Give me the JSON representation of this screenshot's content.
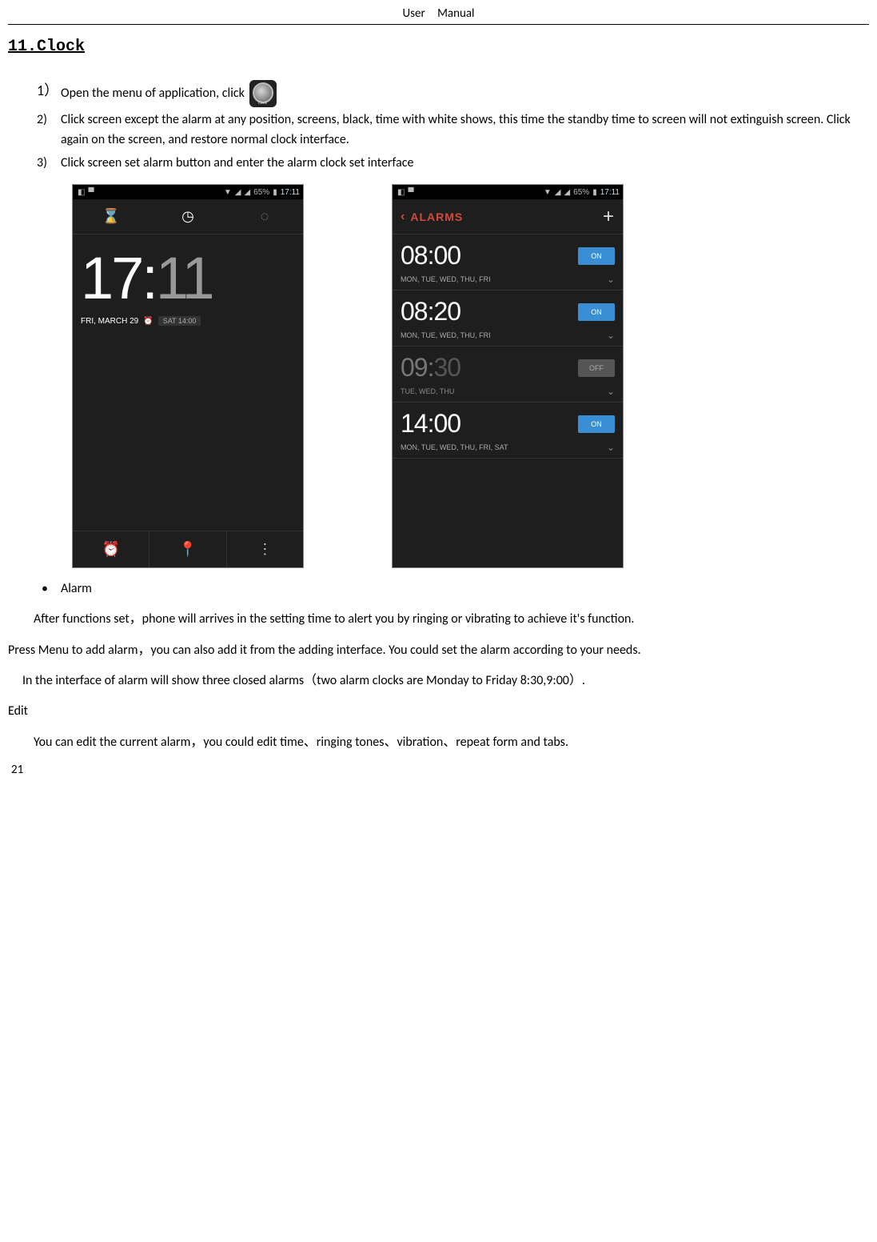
{
  "header": {
    "title": "User  Manual"
  },
  "section": {
    "heading": "11.Clock"
  },
  "steps": {
    "s1_marker": "1）",
    "s1_text": "Open the menu of application, click",
    "s2_marker": "2)",
    "s2_text": "Click screen except the alarm at any position, screens, black, time with white shows, this time the standby time to screen will not extinguish screen. Click again on the screen, and restore normal clock interface.",
    "s3_marker": "3)",
    "s3_text": "Click screen set alarm button and enter the alarm clock set interface"
  },
  "phone_common": {
    "status_battery": "65%",
    "status_time": "17:11"
  },
  "clock_shot": {
    "big_hh": "17",
    "big_colon": ":",
    "big_mm": "11",
    "date_label": "FRI, MARCH 29",
    "next_alarm": "SAT 14:00",
    "tab_timer": "⌛",
    "tab_clock": "◷",
    "tab_stopwatch": "◌",
    "bb_alarm": "⏰",
    "bb_location": "📍",
    "bb_more": "⋮"
  },
  "alarms_shot": {
    "header_back": "‹",
    "header_label": "ALARMS",
    "header_add": "+",
    "items": [
      {
        "hh": "08",
        "mm": "00",
        "days": "MON, TUE, WED, THU, FRI",
        "on": true,
        "toggle": "ON"
      },
      {
        "hh": "08",
        "mm": "20",
        "days": "MON, TUE, WED, THU, FRI",
        "on": true,
        "toggle": "ON"
      },
      {
        "hh": "09",
        "mm": "30",
        "days": "TUE, WED, THU",
        "on": false,
        "toggle": "OFF"
      },
      {
        "hh": "14",
        "mm": "00",
        "days": "MON, TUE, WED, THU, FRI, SAT",
        "on": true,
        "toggle": "ON"
      }
    ],
    "chevron": "⌄"
  },
  "body": {
    "bullet_label": "Alarm",
    "p1": "After functions set，phone will arrives in the setting time to alert you by ringing or vibrating to achieve it's function.",
    "p2": "Press Menu to add alarm，you can also add it from the adding interface. You could set the alarm according to your needs.",
    "p3": "In the interface of alarm will show three closed alarms（two alarm clocks are Monday to Friday 8:30,9:00）.",
    "edit_label": "Edit",
    "p4": "You can edit the current alarm，you could edit time、ringing tones、vibration、repeat form and tabs."
  },
  "page_number": "21"
}
